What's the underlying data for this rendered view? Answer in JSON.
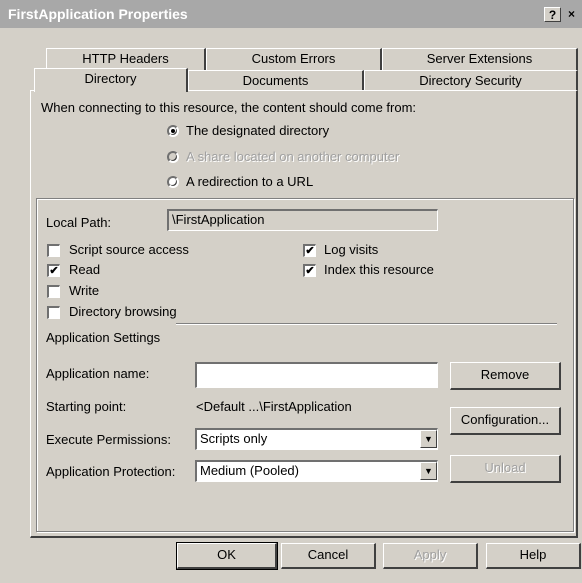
{
  "window": {
    "title": "FirstApplication Properties",
    "help_button": "?",
    "close_button": "×"
  },
  "tabs": {
    "row1": [
      "HTTP Headers",
      "Custom Errors",
      "Server Extensions"
    ],
    "row2": [
      "Directory",
      "Documents",
      "Directory Security"
    ],
    "active": "Directory"
  },
  "content_source": {
    "prompt": "When connecting to this resource, the content should come from:",
    "options": [
      {
        "label": "The designated directory",
        "checked": true,
        "enabled": true
      },
      {
        "label": "A share located on another computer",
        "checked": false,
        "enabled": false
      },
      {
        "label": "A redirection to a URL",
        "checked": false,
        "enabled": true
      }
    ]
  },
  "local_path": {
    "label": "Local Path:",
    "value": "\\FirstApplication"
  },
  "permissions": {
    "left": [
      {
        "label": "Script source access",
        "checked": false
      },
      {
        "label": "Read",
        "checked": true
      },
      {
        "label": "Write",
        "checked": false
      },
      {
        "label": "Directory browsing",
        "checked": false
      }
    ],
    "right": [
      {
        "label": "Log visits",
        "checked": true
      },
      {
        "label": "Index this resource",
        "checked": true
      }
    ]
  },
  "app_settings": {
    "section_label": "Application Settings",
    "name_label": "Application name:",
    "name_value": "",
    "remove_button": "Remove",
    "starting_point_label": "Starting point:",
    "starting_point_value": "<Default ...\\FirstApplication",
    "configuration_button": "Configuration...",
    "execute_label": "Execute Permissions:",
    "execute_value": "Scripts only",
    "protection_label": "Application Protection:",
    "protection_value": "Medium (Pooled)",
    "unload_button": "Unload"
  },
  "footer": {
    "ok": "OK",
    "cancel": "Cancel",
    "apply": "Apply",
    "help": "Help"
  }
}
